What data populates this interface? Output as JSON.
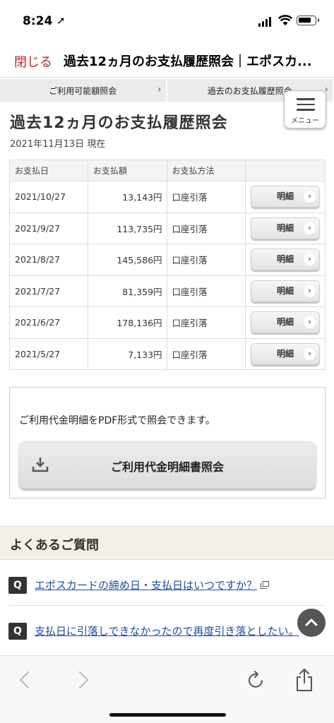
{
  "status_bar": {
    "time": "8:24",
    "location_arrow": "➚"
  },
  "nav": {
    "close_label": "閉じる",
    "title": "過去12ヵ月のお支払履歴照会｜エポスカ..."
  },
  "tabs": [
    {
      "label": "ご利用可能額照会"
    },
    {
      "label": "過去のお支払履歴照会"
    }
  ],
  "menu": {
    "label": "メニュー"
  },
  "page": {
    "title": "過去12ヵ月のお支払履歴照会",
    "date": "2021年11月13日 現在"
  },
  "table": {
    "headers": [
      "お支払日",
      "お支払額",
      "お支払方法",
      ""
    ],
    "detail_label": "明細",
    "rows": [
      {
        "date": "2021/10/27",
        "amount": "13,143円",
        "method": "口座引落"
      },
      {
        "date": "2021/9/27",
        "amount": "113,735円",
        "method": "口座引落"
      },
      {
        "date": "2021/8/27",
        "amount": "145,586円",
        "method": "口座引落"
      },
      {
        "date": "2021/7/27",
        "amount": "81,359円",
        "method": "口座引落"
      },
      {
        "date": "2021/6/27",
        "amount": "178,136円",
        "method": "口座引落"
      },
      {
        "date": "2021/5/27",
        "amount": "7,133円",
        "method": "口座引落"
      }
    ]
  },
  "pdf": {
    "message": "ご利用代金明細をPDF形式で照会できます。",
    "button_label": "ご利用代金明細書照会"
  },
  "faq": {
    "heading": "よくあるご質問",
    "items": [
      {
        "q": "Q",
        "text": "エポスカードの締め日・支払日はいつですか？"
      },
      {
        "q": "Q",
        "text": "支払日に引落しできなかったので再度引き落としたい。"
      }
    ]
  },
  "colors": {
    "accent_red": "#b8262b",
    "link_blue": "#1a4d9e",
    "faq_bg": "#f3f0e8"
  },
  "icons": [
    "location-arrow-icon",
    "cellular-signal-icon",
    "wifi-icon",
    "battery-icon",
    "chevron-right-icon",
    "hamburger-menu-icon",
    "download-icon",
    "external-link-icon",
    "arrow-up-icon",
    "back-icon",
    "forward-icon",
    "reload-icon",
    "share-icon"
  ]
}
